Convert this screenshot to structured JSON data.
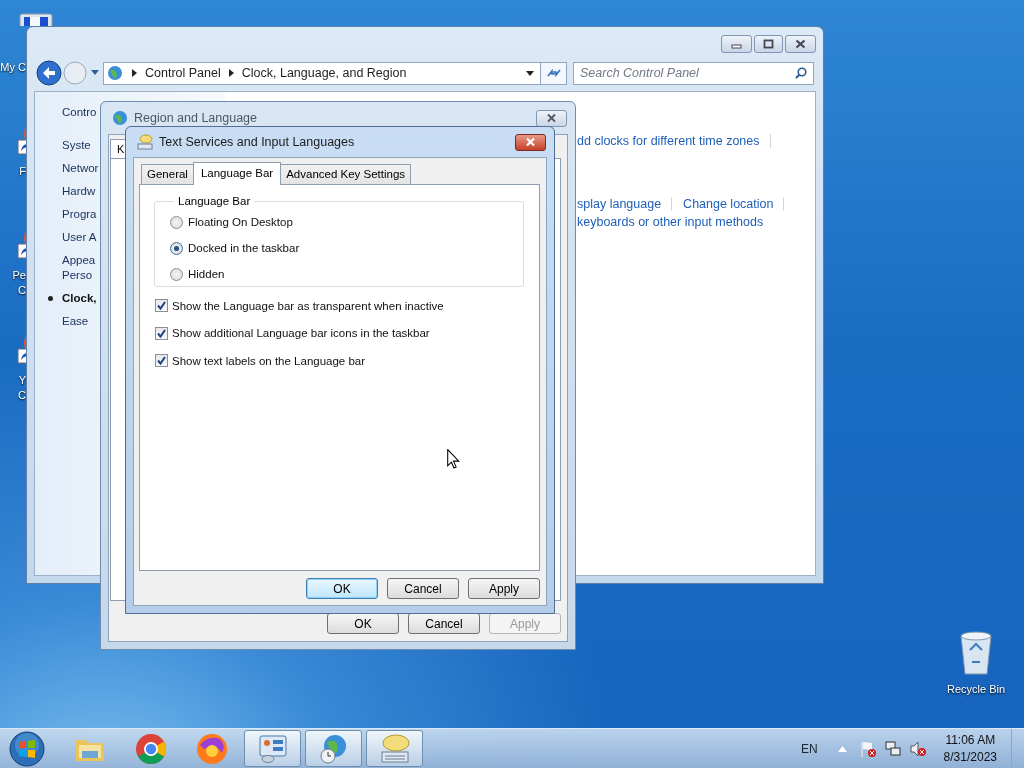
{
  "desktop": {
    "icons": [
      {
        "kind": "computer",
        "label_lines": [
          "My C"
        ]
      },
      {
        "kind": "shortcut",
        "label_lines": [
          "F"
        ]
      },
      {
        "kind": "shortcut",
        "label_lines": [
          "Pe",
          "C"
        ]
      },
      {
        "kind": "shortcut",
        "label_lines": [
          "Y",
          "C"
        ]
      }
    ],
    "recycle_bin": {
      "label": "Recycle Bin"
    }
  },
  "control_panel": {
    "breadcrumb": [
      "Control Panel",
      "Clock, Language, and Region"
    ],
    "search": {
      "placeholder": "Search Control Panel"
    },
    "sidebar": [
      {
        "kind": "home",
        "lines": [
          "Contro"
        ],
        "selected": false
      },
      {
        "kind": "category",
        "lines": [
          "Syste"
        ],
        "selected": false
      },
      {
        "kind": "category",
        "lines": [
          "Networ"
        ],
        "selected": false
      },
      {
        "kind": "category",
        "lines": [
          "Hardw"
        ],
        "selected": false
      },
      {
        "kind": "category",
        "lines": [
          "Progra"
        ],
        "selected": false
      },
      {
        "kind": "category",
        "lines": [
          "User A"
        ],
        "selected": false
      },
      {
        "kind": "category",
        "lines": [
          "Appea",
          "Perso"
        ],
        "selected": false
      },
      {
        "kind": "category",
        "lines": [
          "Clock,"
        ],
        "selected": true
      },
      {
        "kind": "category",
        "lines": [
          "Ease"
        ],
        "selected": false
      }
    ],
    "task_links": [
      [
        {
          "text": "dd clocks for different time zones",
          "separated": true
        }
      ],
      [
        {
          "text": "splay language",
          "separated": true
        },
        {
          "text": "Change location",
          "separated": true
        }
      ],
      [
        {
          "text": "keyboards or other input methods",
          "separated": false
        }
      ]
    ]
  },
  "region_dialog": {
    "title": "Region and Language",
    "tabs": [
      {
        "label": "K"
      }
    ],
    "buttons": [
      {
        "label": "OK",
        "disabled": false
      },
      {
        "label": "Cancel",
        "disabled": false
      },
      {
        "label": "Apply",
        "disabled": true
      }
    ]
  },
  "text_services_dialog": {
    "title": "Text Services and Input Languages",
    "tabs": [
      {
        "label": "General",
        "selected": false
      },
      {
        "label": "Language Bar",
        "selected": true
      },
      {
        "label": "Advanced Key Settings",
        "selected": false
      }
    ],
    "group": {
      "legend": "Language Bar",
      "options": [
        {
          "label": "Floating On Desktop",
          "selected": false
        },
        {
          "label": "Docked in the taskbar",
          "selected": true
        },
        {
          "label": "Hidden",
          "selected": false
        }
      ]
    },
    "checkboxes": [
      {
        "label": "Show the Language bar as transparent when inactive",
        "checked": true
      },
      {
        "label": "Show additional Language bar icons in the taskbar",
        "checked": true
      },
      {
        "label": "Show text labels on the Language bar",
        "checked": true
      }
    ],
    "buttons": [
      {
        "label": "OK",
        "default": true
      },
      {
        "label": "Cancel",
        "default": false
      },
      {
        "label": "Apply",
        "default": false
      }
    ]
  },
  "taskbar": {
    "apps": [
      {
        "kind": "explorer",
        "active": false
      },
      {
        "kind": "chrome",
        "active": false
      },
      {
        "kind": "firefox",
        "active": false
      },
      {
        "kind": "control-panel",
        "active": true
      },
      {
        "kind": "region",
        "active": true
      },
      {
        "kind": "text-services",
        "active": true
      }
    ],
    "language": "EN",
    "tray": [
      {
        "kind": "flag"
      },
      {
        "kind": "network"
      },
      {
        "kind": "volume"
      }
    ],
    "time": "11:06 AM",
    "date": "8/31/2023"
  }
}
